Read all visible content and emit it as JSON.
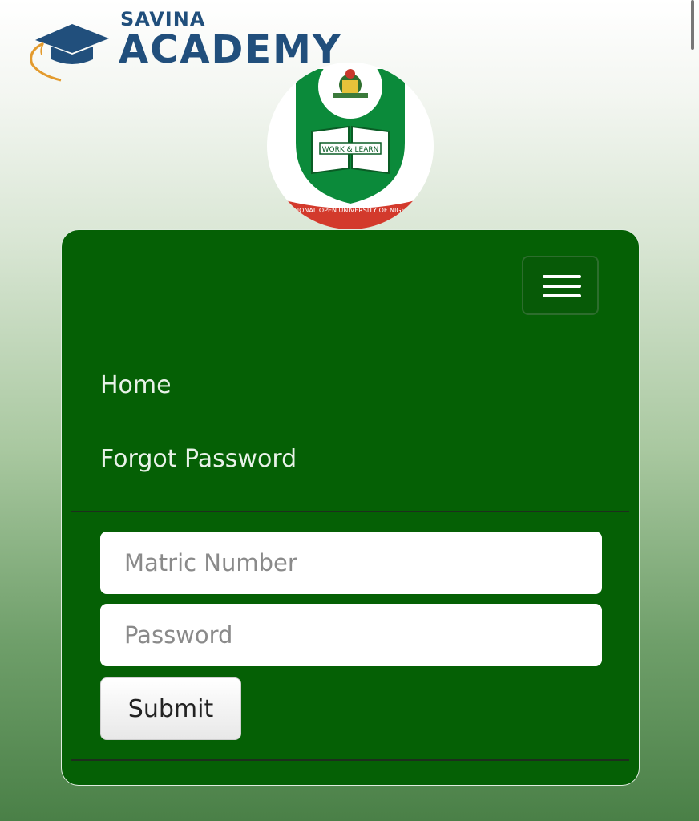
{
  "brand": {
    "small": "SAVINA",
    "big": "ACADEMY",
    "color": "#214f7c"
  },
  "logo": {
    "inner_label": "WORK & LEARN",
    "ribbon_text": "NATIONAL OPEN UNIVERSITY OF NIGERIA",
    "colors": {
      "green": "#0b8a3a",
      "red": "#d33a2c",
      "white": "#ffffff"
    }
  },
  "nav": {
    "toggle_icon": "hamburger-icon",
    "items": [
      {
        "label": "Home"
      },
      {
        "label": "Forgot Password"
      }
    ]
  },
  "form": {
    "matric_placeholder": "Matric Number",
    "password_placeholder": "Password",
    "submit_label": "Submit"
  },
  "theme": {
    "card_bg": "#056005"
  }
}
